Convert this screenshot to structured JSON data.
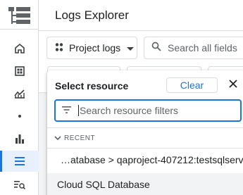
{
  "header": {
    "title": "Logs Explorer"
  },
  "toolbar": {
    "project_selector_label": "Project logs",
    "search_placeholder": "Search all fields"
  },
  "sidebar": {
    "items": [
      {
        "icon": "home-icon"
      },
      {
        "icon": "dashboard-icon"
      },
      {
        "icon": "metrics-chart-icon"
      },
      {
        "icon": "dot-icon"
      },
      {
        "icon": "bar-chart-icon"
      },
      {
        "icon": "logs-list-icon",
        "active": true
      },
      {
        "icon": "log-search-icon"
      }
    ]
  },
  "resource_panel": {
    "title": "Select resource",
    "clear_label": "Clear",
    "filter_placeholder": "Search resource filters",
    "filter_value": "",
    "recent_section_label": "RECENT",
    "items": [
      {
        "label": "…atabase > qaproject-407212:testsqlserver"
      },
      {
        "label": "Cloud SQL Database"
      }
    ]
  },
  "colors": {
    "accent": "#1a73e8",
    "text": "#202124",
    "muted": "#5f6368",
    "border": "#dadce0",
    "active_bg": "#e8f0fe"
  }
}
